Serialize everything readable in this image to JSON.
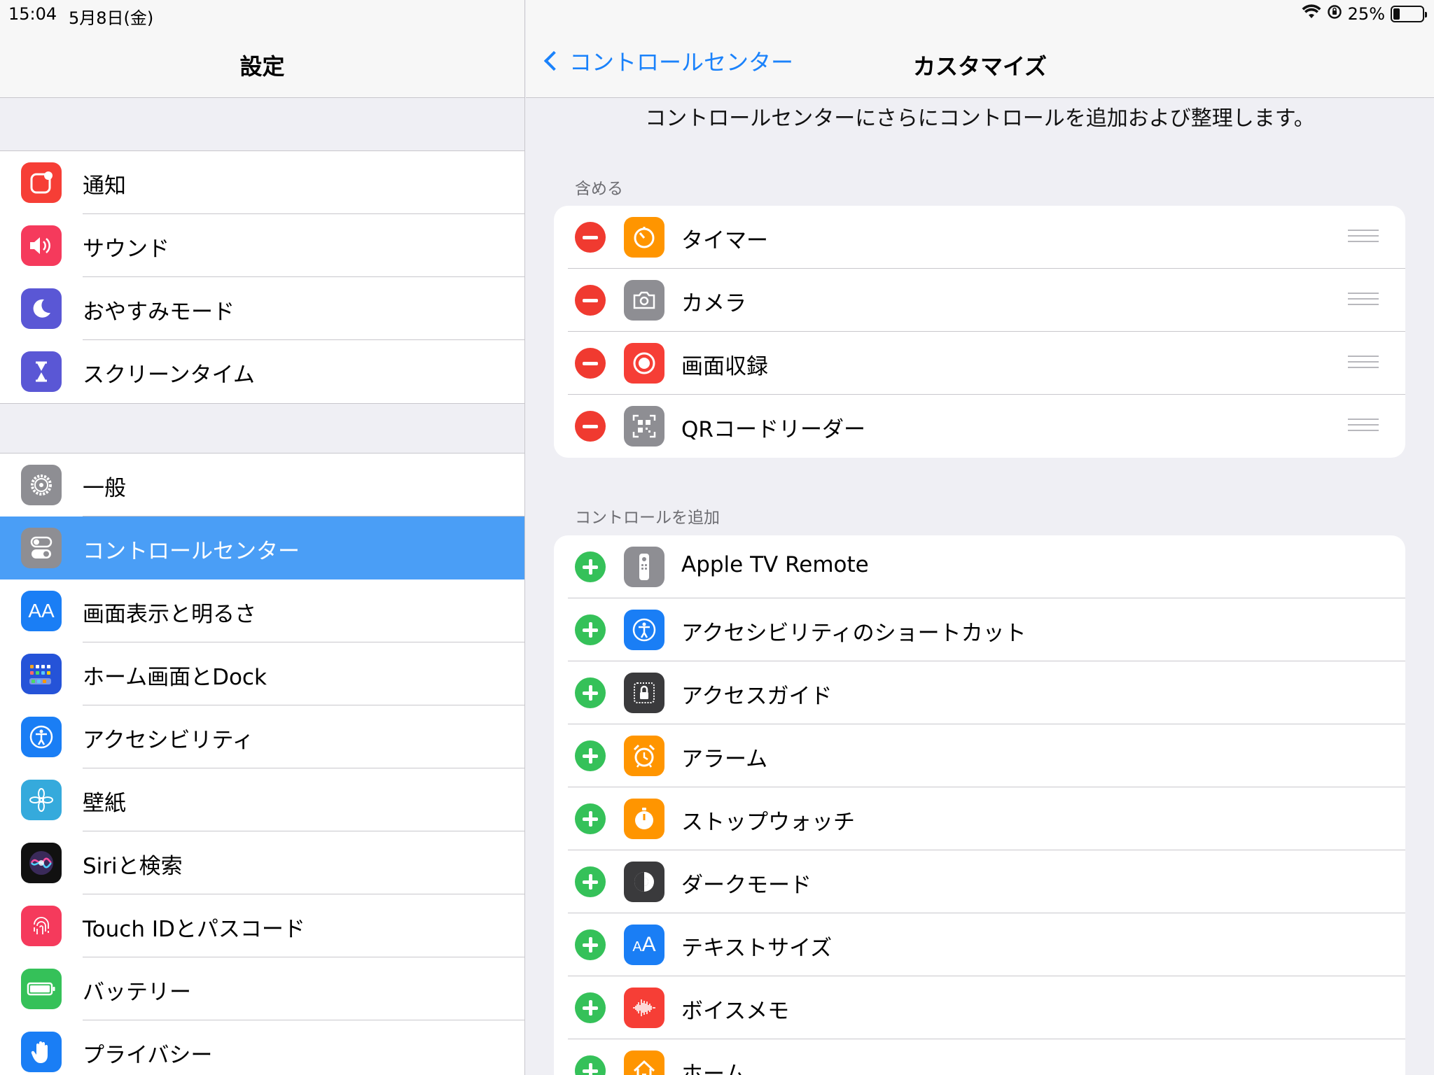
{
  "status": {
    "time": "15:04",
    "date": "5月8日(金)",
    "battery": "25%",
    "battery_level": 0.25
  },
  "master": {
    "title": "設定",
    "group1": [
      {
        "label": "通知",
        "icon": "notifications-icon",
        "color": "#f63e36"
      },
      {
        "label": "サウンド",
        "icon": "sounds-icon",
        "color": "#f53a5c"
      },
      {
        "label": "おやすみモード",
        "icon": "moon-icon",
        "color": "#5a57d5"
      },
      {
        "label": "スクリーンタイム",
        "icon": "hourglass-icon",
        "color": "#5a57d5"
      }
    ],
    "group2": [
      {
        "label": "一般",
        "icon": "gear-icon",
        "color": "#8e8e93"
      },
      {
        "label": "コントロールセンター",
        "icon": "switches-icon",
        "color": "#8e8e93",
        "selected": true
      },
      {
        "label": "画面表示と明るさ",
        "icon": "text-size-icon",
        "color": "#1a7ef5"
      },
      {
        "label": "ホーム画面とDock",
        "icon": "home-grid-icon",
        "color": "#2553d8"
      },
      {
        "label": "アクセシビリティ",
        "icon": "accessibility-icon",
        "color": "#1a7ef5"
      },
      {
        "label": "壁紙",
        "icon": "flower-icon",
        "color": "#35aadc"
      },
      {
        "label": "Siriと検索",
        "icon": "siri-icon",
        "color": "#111111"
      },
      {
        "label": "Touch IDとパスコード",
        "icon": "fingerprint-icon",
        "color": "#f53a5c"
      },
      {
        "label": "バッテリー",
        "icon": "battery-icon",
        "color": "#35c159"
      },
      {
        "label": "プライバシー",
        "icon": "hand-icon",
        "color": "#1a7ef5"
      }
    ]
  },
  "detail": {
    "back_label": "コントロールセンター",
    "title": "カスタマイズ",
    "description": "コントロールセンターにさらにコントロールを追加および整理します。",
    "include_header": "含める",
    "included": [
      {
        "label": "タイマー",
        "icon": "timer-icon",
        "color": "#ff9500"
      },
      {
        "label": "カメラ",
        "icon": "camera-icon",
        "color": "#8e8e93"
      },
      {
        "label": "画面収録",
        "icon": "record-icon",
        "color": "#f63e36"
      },
      {
        "label": "QRコードリーダー",
        "icon": "qr-code-icon",
        "color": "#8e8e93"
      }
    ],
    "more_header": "コントロールを追加",
    "more": [
      {
        "label": "Apple TV Remote",
        "icon": "remote-icon",
        "color": "#8e8e93"
      },
      {
        "label": "アクセシビリティのショートカット",
        "icon": "accessibility-icon",
        "color": "#1a7ef5"
      },
      {
        "label": "アクセスガイド",
        "icon": "lock-icon",
        "color": "#3a3a3c"
      },
      {
        "label": "アラーム",
        "icon": "alarm-icon",
        "color": "#ff9500"
      },
      {
        "label": "ストップウォッチ",
        "icon": "stopwatch-icon",
        "color": "#ff9500"
      },
      {
        "label": "ダークモード",
        "icon": "dark-mode-icon",
        "color": "#3a3a3c"
      },
      {
        "label": "テキストサイズ",
        "icon": "text-size-icon",
        "color": "#1a7ef5"
      },
      {
        "label": "ボイスメモ",
        "icon": "voice-memo-icon",
        "color": "#f63e36"
      },
      {
        "label": "ホーム",
        "icon": "home-icon",
        "color": "#ff9500"
      }
    ]
  }
}
